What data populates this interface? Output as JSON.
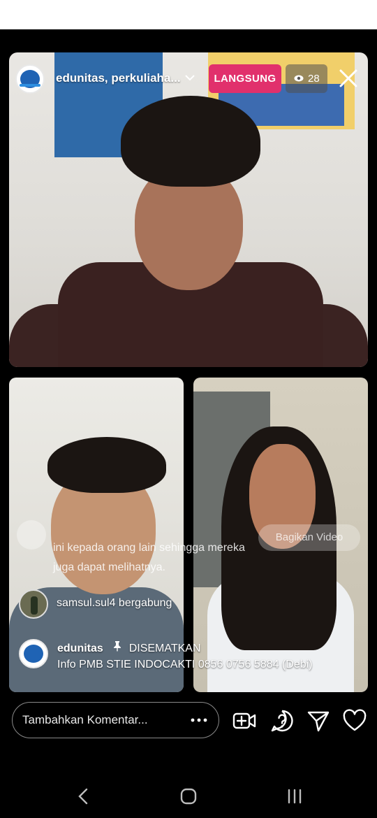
{
  "header": {
    "host_name": "edunitas, perkuliaha...",
    "live_label": "LANGSUNG",
    "viewer_count": "28"
  },
  "overlay": {
    "share_label": "Bagikan Video",
    "faded_comment": "ini kepada orang lain sehingga mereka juga dapat melihatnya.",
    "join_message": "samsul.sul4 bergabung"
  },
  "pinned": {
    "user": "edunitas",
    "label": "DISEMATKAN",
    "text": "Info PMB STIE INDOCAKTI 0856 0756 5884 (Debi)"
  },
  "composer": {
    "placeholder": "Tambahkan Komentar..."
  },
  "icons": {
    "chevron": "chevron-down-icon",
    "eye": "eye-icon",
    "close": "close-icon",
    "pin": "pin-icon",
    "more": "more-icon",
    "add_guest": "video-add-icon",
    "question": "question-icon",
    "send": "send-icon",
    "like": "heart-icon"
  },
  "colors": {
    "live": "#e1306c",
    "background": "#000000"
  }
}
